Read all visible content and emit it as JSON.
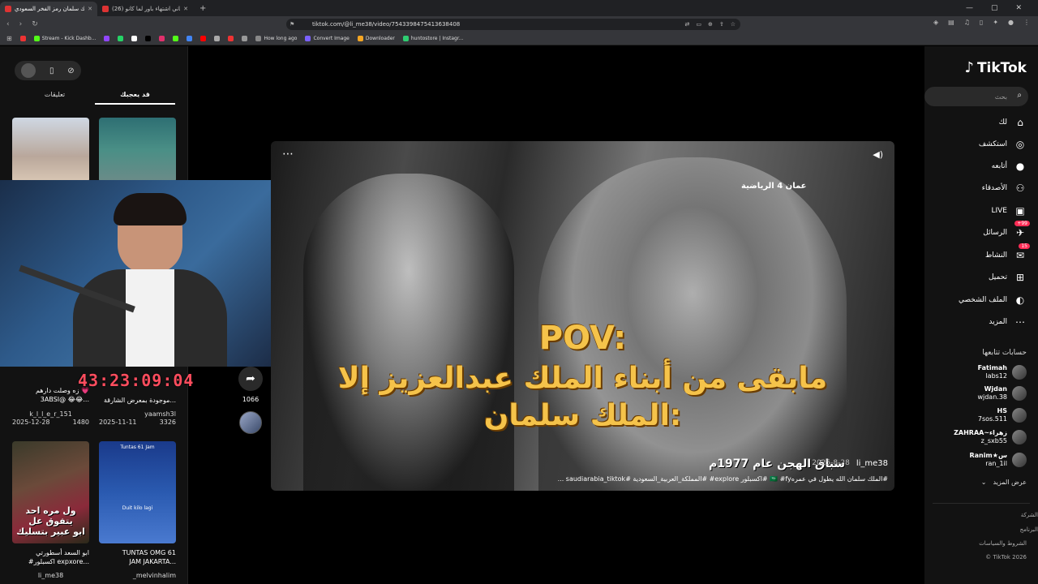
{
  "browser": {
    "tabs": [
      {
        "label": "الملك سلمان رمز الفخر السعودي |",
        "active": true
      },
      {
        "label": "(26) حلقت اغاني اشتهاء باور لما كانو...",
        "active": false
      }
    ],
    "new_tab": "+",
    "window_controls": [
      "—",
      "▢",
      "✕"
    ],
    "url": "tiktok.com/@li_me38/video/7543398475413638408",
    "bookmarks": [
      {
        "label": "",
        "color": "#e33"
      },
      {
        "label": "Stream - Kick Dashb...",
        "color": "#53fc18"
      },
      {
        "label": "",
        "color": "#9146ff"
      },
      {
        "label": "",
        "color": "#25d366"
      },
      {
        "label": "",
        "color": "#fff"
      },
      {
        "label": "",
        "color": "#000"
      },
      {
        "label": "",
        "color": "#e1306c"
      },
      {
        "label": "",
        "color": "#53fc18"
      },
      {
        "label": "",
        "color": "#4285f4"
      },
      {
        "label": "",
        "color": "#f00"
      },
      {
        "label": "",
        "color": "#aaa"
      },
      {
        "label": "",
        "color": "#e33"
      },
      {
        "label": "",
        "color": "#999"
      },
      {
        "label": "How long ago",
        "color": "#888"
      },
      {
        "label": "Convert Image",
        "color": "#7b61ff"
      },
      {
        "label": "Downloader",
        "color": "#f5a623"
      },
      {
        "label": "huntostore | Instagr...",
        "color": "#2ecc71"
      }
    ]
  },
  "left_panel": {
    "tabs": [
      "تعليقات",
      "قد يعجبك"
    ],
    "timer": "43:23:09:04",
    "share_count": "1066",
    "thumbnails": [
      {
        "caption": "",
        "views": "",
        "date": "",
        "user": ""
      },
      {
        "caption": "",
        "views": "",
        "date": "",
        "user": ""
      },
      {
        "caption": "زه وصلت دارهم 💗\n3ABSI@ 😂😂...",
        "views": "1480",
        "date": "2025-12-28",
        "user": "k_l_l_e_r_151"
      },
      {
        "caption": "موجودة بمعرض الشارقة...",
        "views": "3326",
        "date": "2025-11-11",
        "user": "yaamsh3l"
      },
      {
        "caption": "ابو السعد أسطورتي\n#اكسبلور expxore...",
        "views": "",
        "date": "",
        "user": "li_me38"
      },
      {
        "caption": "TUNTAS OMG 61\nJAM JAKARTA...",
        "views": "",
        "date": "",
        "user": "_melvinhalim"
      }
    ],
    "thumb_overlay_1": "ول مره احد يتفوق عل\nابو عبير بتسليك",
    "thumb_overlay_2": "Tuntas 61 Jam",
    "thumb_overlay_3": "Duit kilo lagi"
  },
  "video": {
    "pov": "POV:",
    "line1": "مابقى من أبناء الملك عبدالعزيز إلا",
    "line2": "الملك سلمان:",
    "channel_logo": "عمان 4 الرياضية",
    "subtitle": "سباق الهجن عام 1977م",
    "username": "li_me38",
    "date": "2025-8-28",
    "caption": "#الملك سلمان الله يطول في عمره🇸🇦 #fy #اكسبلور explore# #المملكة_العربية_السعودية #saudiarabia_tiktok ..."
  },
  "right_nav": {
    "logo": "TikTok",
    "search_placeholder": "بحث",
    "items": [
      {
        "label": "لك",
        "icon": "⌂"
      },
      {
        "label": "استكشف",
        "icon": "◎"
      },
      {
        "label": "أتابعه",
        "icon": "●"
      },
      {
        "label": "الأصدقاء",
        "icon": "⚇"
      },
      {
        "label": "LIVE",
        "icon": "▣"
      },
      {
        "label": "الرسائل",
        "icon": "✈",
        "badge": "+99"
      },
      {
        "label": "النشاط",
        "icon": "✉",
        "badge": "15"
      },
      {
        "label": "تحميل",
        "icon": "⊞"
      },
      {
        "label": "الملف الشخصي",
        "icon": "◐"
      },
      {
        "label": "المزيد",
        "icon": "⋯"
      }
    ],
    "following_title": "حسابات تتابعها",
    "accounts": [
      {
        "name": "Fatimah",
        "handle": "labs12"
      },
      {
        "name": "Wjdan",
        "handle": "wjdan.38"
      },
      {
        "name": "HS",
        "handle": "7sos.511"
      },
      {
        "name": "ZAHRAA~زهراء",
        "handle": "z_sxb55"
      },
      {
        "name": "Ranim★س",
        "handle": "ran_1il"
      }
    ],
    "see_more": "عرض المزيد",
    "footer": [
      "الشركة",
      "البرنامج",
      "الشروط والسياسات",
      "© TikTok 2026"
    ]
  },
  "colors": {
    "accent": "#fe2c55",
    "timer": "#ff4d5e",
    "pov_text": "#f5c34a"
  }
}
